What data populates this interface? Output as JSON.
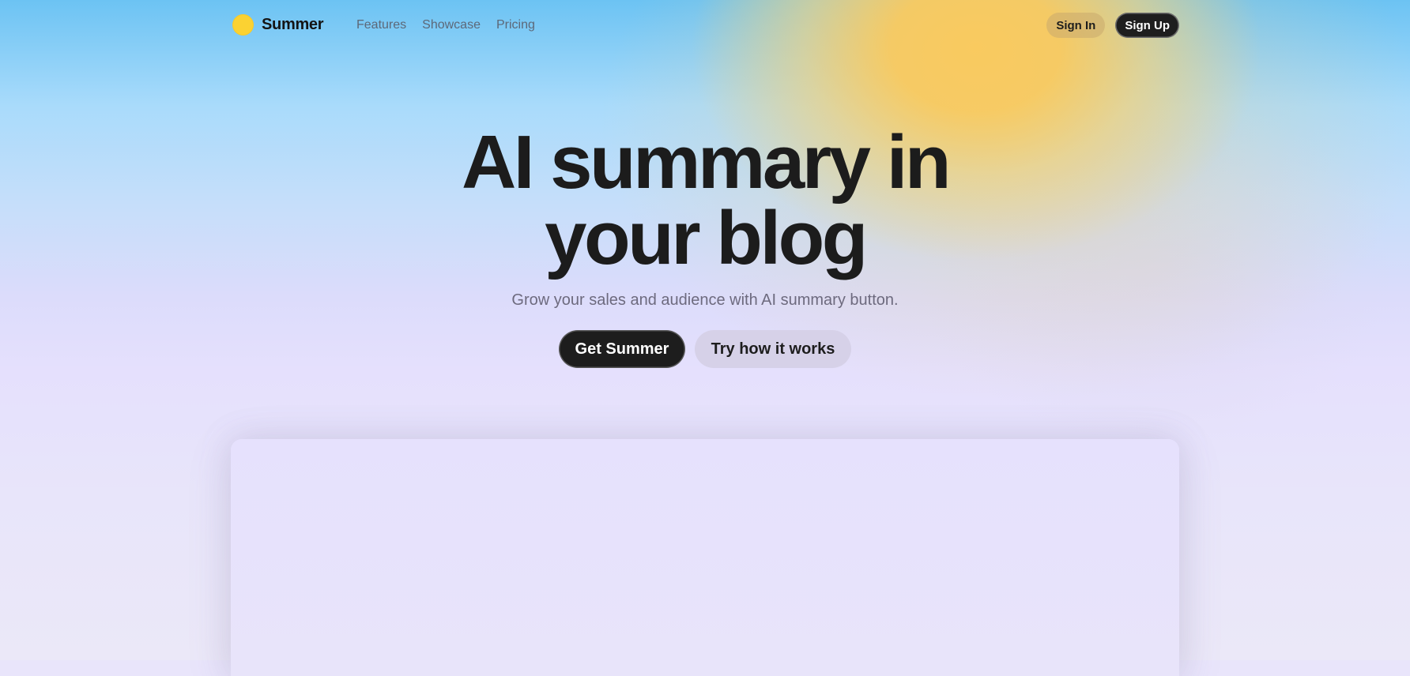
{
  "brand": {
    "name": "Summer",
    "logo_icon": "sun-dot-icon",
    "logo_color": "#fbd232"
  },
  "nav": {
    "links": [
      "Features",
      "Showcase",
      "Pricing"
    ],
    "sign_in_label": "Sign In",
    "sign_up_label": "Sign Up"
  },
  "hero": {
    "title_line1": "AI summary in",
    "title_line2": "your blog",
    "subtitle": "Grow your sales and audience with AI summary button.",
    "primary_cta": "Get Summer",
    "secondary_cta": "Try how it works"
  },
  "colors": {
    "dark_button": "#1d1d1d",
    "sun_glow": "#f9ca5f",
    "sky_blue": "#6cc3f3",
    "lavender": "#e5e0fd"
  }
}
